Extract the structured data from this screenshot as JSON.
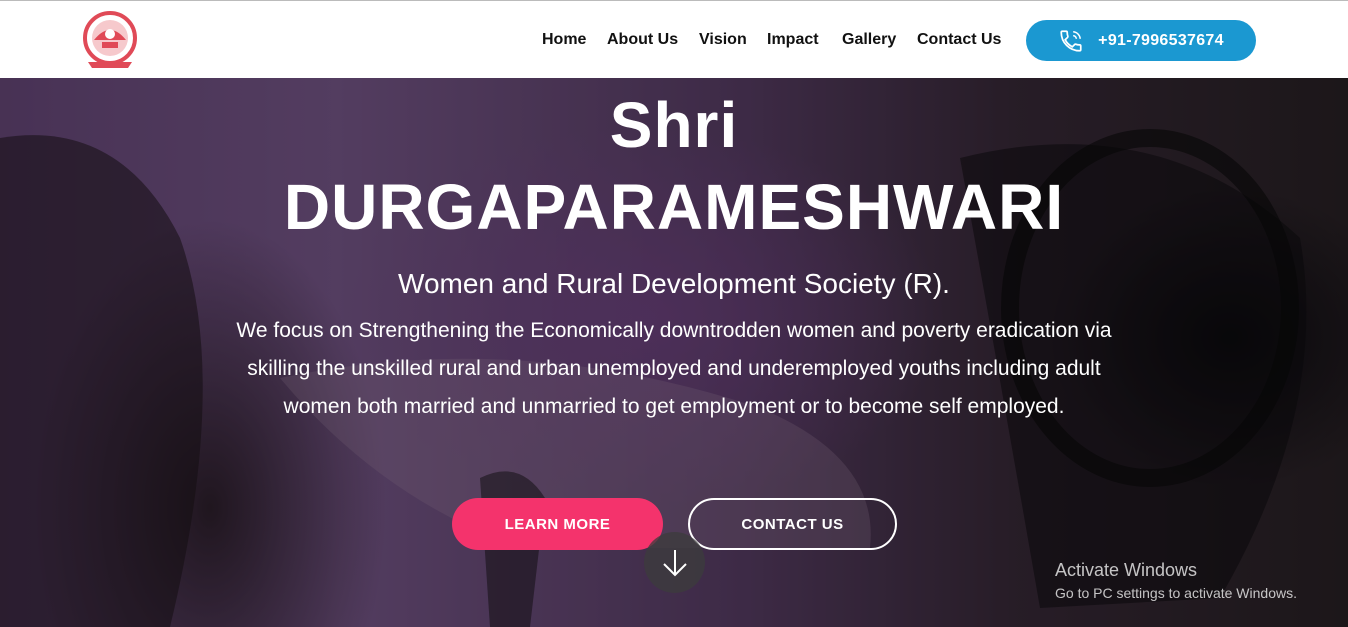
{
  "header": {
    "logo_icon": "org-emblem-icon",
    "nav": [
      "Home",
      "About Us",
      "Vision",
      "Impact",
      "Gallery",
      "Contact Us"
    ],
    "phone_icon": "phone-icon",
    "phone": "+91-7996537674",
    "accent_color": "#1b98d1"
  },
  "hero": {
    "title_line1": "Shri",
    "title_line2": "DURGAPARAMESHWARI",
    "subtitle": "Women and Rural Development Society (R).",
    "description": "We focus on Strengthening the Economically downtrodden women and poverty eradication via skilling the unskilled rural and urban unemployed and underemployed youths including adult women both married and unmarried to get employment or to become self employed.",
    "learn_more": "LEARN MORE",
    "contact_us": "CONTACT US",
    "scroll_icon": "arrow-down-icon",
    "primary_color": "#f4336c"
  },
  "watermark": {
    "title": "Activate Windows",
    "subtitle": "Go to PC settings to activate Windows."
  }
}
